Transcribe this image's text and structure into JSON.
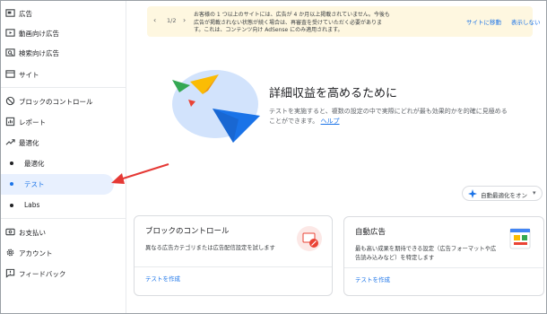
{
  "sidebar": {
    "items": [
      {
        "label": "広告",
        "icon": "ad-icon"
      },
      {
        "label": "動画向け広告",
        "icon": "video-ad-icon"
      },
      {
        "label": "検索向け広告",
        "icon": "search-ad-icon"
      },
      {
        "label": "サイト",
        "icon": "sites-icon"
      },
      {
        "label": "ブロックのコントロール",
        "icon": "block-icon"
      },
      {
        "label": "レポート",
        "icon": "report-icon"
      },
      {
        "label": "最適化",
        "icon": "trending-up-icon"
      },
      {
        "label": "最適化"
      },
      {
        "label": "テスト"
      },
      {
        "label": "Labs"
      },
      {
        "label": "お支払い",
        "icon": "payments-icon"
      },
      {
        "label": "アカウント",
        "icon": "gear-icon"
      },
      {
        "label": "フィードバック",
        "icon": "feedback-icon"
      }
    ]
  },
  "banner": {
    "count": "1/2",
    "text": "お客様の 1 つ以上のサイトには、広告が 4 か月以上掲載されていません。今後も広告が掲載されない状態が続く場合は、再審査を受けていただく必要があります。これは、コンテンツ向け AdSense にのみ適用されます。",
    "site_link": "サイトに移動",
    "hide_link": "表示しない"
  },
  "hero": {
    "title": "詳細収益を高めるために",
    "description": "テストを実施すると、複数の設定の中で実際にどれが最も効果的かを的確に見極めることができます。",
    "help_link": "ヘルプ"
  },
  "auto_button": {
    "label": "自動最適化をオン"
  },
  "cards": [
    {
      "title": "ブロックのコントロール",
      "description": "異なる広告カテゴリまたは広告配信設定を試します",
      "action": "テストを作成"
    },
    {
      "title": "自動広告",
      "description": "最も高い成果を期待できる設定（広告フォーマットや広告読み込みなど）を特定します",
      "action": "テストを作成"
    }
  ],
  "colors": {
    "accent": "#1a73e8",
    "active_bg": "#e8f0fe",
    "banner_bg": "#fef7e0",
    "arrow": "#e53935"
  }
}
